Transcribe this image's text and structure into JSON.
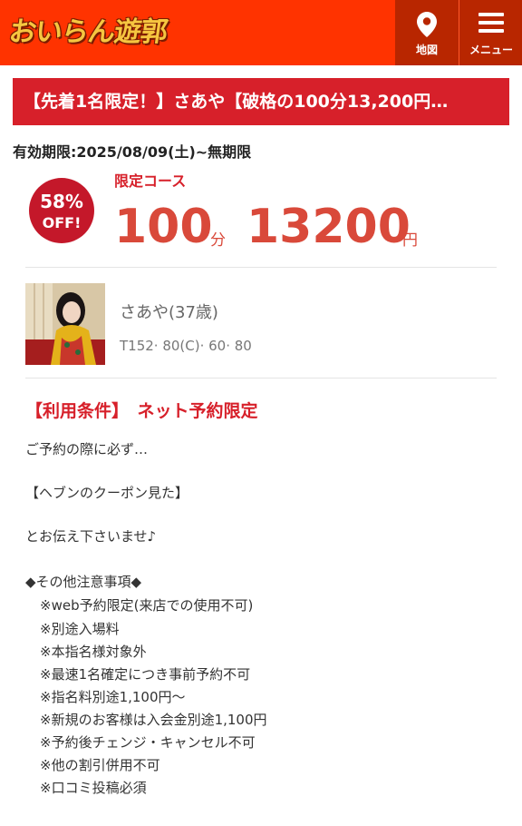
{
  "header": {
    "logo_text": "おいらん遊郭",
    "map_label": "地図",
    "menu_label": "メニュー",
    "bg_color": "#ff3300"
  },
  "coupon": {
    "title": "【先着1名限定！】さあや【破格の100分13,200円…",
    "validity": "有効期限:2025/08/09(土)~無期限",
    "discount_pct": "58%",
    "discount_off": "OFF!",
    "course_label": "限定コース",
    "minutes": "100",
    "minutes_unit": "分",
    "price": "13200",
    "price_unit": "円"
  },
  "girl": {
    "name": "さあや(37歳)",
    "stats": "T152· 80(C)· 60· 80"
  },
  "conditions": {
    "title": "【利用条件】　ネット予約限定",
    "intro_1": "ご予約の際に必ず…",
    "intro_2": "【ヘブンのクーポン見た】",
    "intro_3": "とお伝え下さいませ♪",
    "notes_heading": "◆その他注意事項◆",
    "notes": [
      "※web予約限定(来店での使用不可)",
      "※別途入場料",
      "※本指名様対象外",
      "※最速1名確定につき事前予約不可",
      "※指名料別途1,100円～",
      "※新規のお客様は入会金別途1,100円",
      "※予約後チェンジ・キャンセル不可",
      "※他の割引併用不可",
      "※口コミ投稿必須"
    ]
  },
  "colors": {
    "accent_red": "#d7202a",
    "price_red": "#d9493a",
    "badge_red": "#c4182a"
  }
}
